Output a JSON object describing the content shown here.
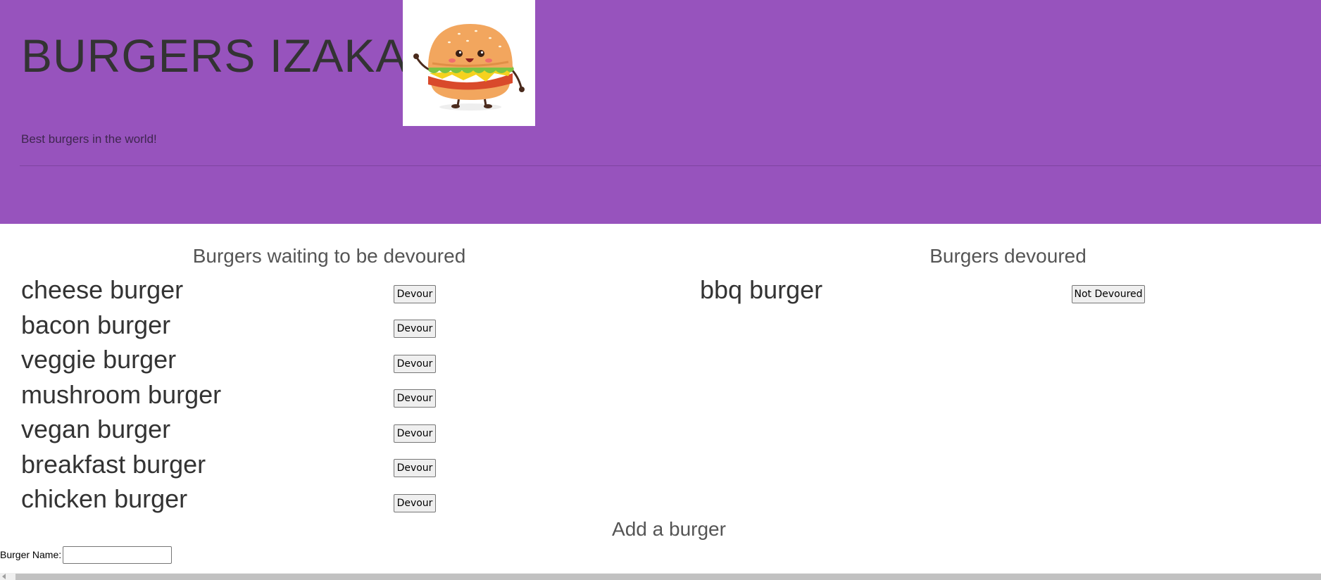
{
  "header": {
    "title": "BURGERS IZAKAYA",
    "tagline": "Best burgers in the world!",
    "logo_icon": "cartoon-burger-icon",
    "background": "#9753bd"
  },
  "waiting": {
    "title": "Burgers waiting to be devoured",
    "button_label": "Devour",
    "items": [
      {
        "name": "cheese burger"
      },
      {
        "name": "bacon burger"
      },
      {
        "name": "veggie burger"
      },
      {
        "name": "mushroom burger"
      },
      {
        "name": "vegan burger"
      },
      {
        "name": "breakfast burger"
      },
      {
        "name": "chicken burger"
      }
    ]
  },
  "devoured": {
    "title": "Burgers devoured",
    "button_label": "Not Devoured",
    "items": [
      {
        "name": "bbq burger"
      }
    ]
  },
  "add_form": {
    "title": "Add a burger",
    "label": "Burger Name:",
    "value": "",
    "placeholder": ""
  }
}
